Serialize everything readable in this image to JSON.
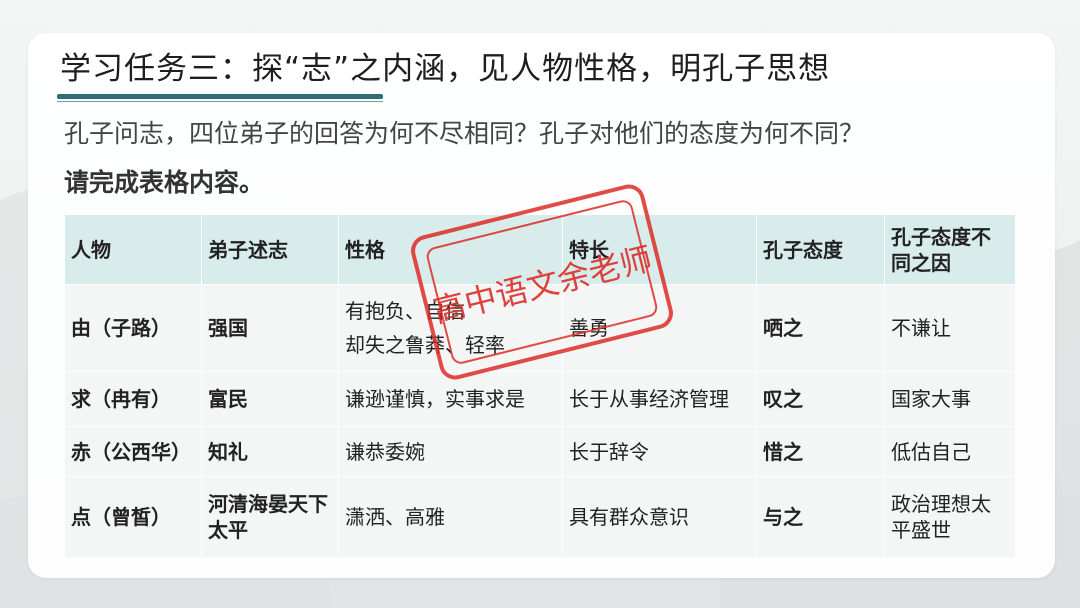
{
  "title": "学习任务三：探“志”之内涵，见人物性格，明孔子思想",
  "question": "孔子问志，四位弟子的回答为何不尽相同？孔子对他们的态度为何不同？",
  "instruction": "请完成表格内容。",
  "watermark": "高中语文余老师",
  "table": {
    "headers": [
      "人物",
      "弟子述志",
      "性格",
      "特长",
      "孔子态度",
      "孔子态度不同之因"
    ],
    "rows": [
      {
        "person": "由（子路）",
        "aspiration": "强国",
        "traits": [
          "有抱负、自信",
          "却失之鲁莽、轻率"
        ],
        "specialty": "善勇",
        "attitude": "哂之",
        "reason": "不谦让"
      },
      {
        "person": "求（冉有）",
        "aspiration": "富民",
        "traits": [
          "谦逊谨慎，实事求是"
        ],
        "specialty": "长于从事经济管理",
        "attitude": "叹之",
        "reason": "国家大事"
      },
      {
        "person": "赤（公西华）",
        "aspiration": "知礼",
        "traits": [
          "谦恭委婉"
        ],
        "specialty": "长于辞令",
        "attitude": "惜之",
        "reason": "低估自己"
      },
      {
        "person": "点（曾皙）",
        "aspiration": "河清海晏天下太平",
        "traits": [
          "潇洒、高雅"
        ],
        "specialty": "具有群众意识",
        "attitude": "与之",
        "reason": "政治理想太平盛世"
      }
    ]
  }
}
